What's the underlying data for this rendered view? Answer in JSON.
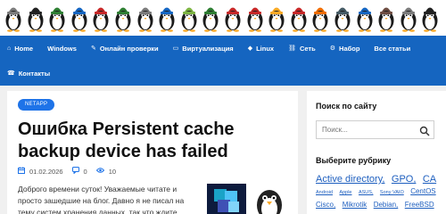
{
  "banner": {
    "penguins": [
      {
        "color": "#7a7a7a"
      },
      {
        "color": "#222222"
      },
      {
        "color": "#2e7d32"
      },
      {
        "color": "#1565c0"
      },
      {
        "color": "#c62828"
      },
      {
        "color": "#2e7d32"
      },
      {
        "color": "#7a7a7a"
      },
      {
        "color": "#1565c0"
      },
      {
        "color": "#7cb342"
      },
      {
        "color": "#2e7d32"
      },
      {
        "color": "#c62828"
      },
      {
        "color": "#c62828"
      },
      {
        "color": "#f9a825"
      },
      {
        "color": "#c62828"
      },
      {
        "color": "#ef6c00"
      },
      {
        "color": "#455a64"
      },
      {
        "color": "#1565c0"
      },
      {
        "color": "#6d4c41"
      },
      {
        "color": "#7a7a7a"
      },
      {
        "color": "#222222"
      }
    ]
  },
  "nav": {
    "row1": [
      {
        "label": "Home",
        "icon": "home-icon"
      },
      {
        "label": "Windows",
        "icon": ""
      },
      {
        "label": "Онлайн проверки",
        "icon": "wrench-icon"
      },
      {
        "label": "Виртуализация",
        "icon": "desktop-icon"
      },
      {
        "label": "Linux",
        "icon": "linux-icon"
      },
      {
        "label": "Сеть",
        "icon": "network-icon"
      },
      {
        "label": "Набор",
        "icon": "gear-icon"
      },
      {
        "label": "Все статьи",
        "icon": ""
      }
    ],
    "row2": [
      {
        "label": "Контакты",
        "icon": "phone-icon"
      }
    ]
  },
  "article": {
    "tag": "NETAPP",
    "title": "Ошибка Persistent cache backup device has failed",
    "date": "01.02.2026",
    "comments": "0",
    "views": "10",
    "excerpt": "Доброго времени суток! Уважаемые читате и просто зашедшие на блог. Давно я не писал на тему систем хранения данных, так что ждите"
  },
  "sidebar": {
    "search_title": "Поиск по сайту",
    "search_placeholder": "Поиск...",
    "categories_title": "Выберите рубрику",
    "categories": [
      {
        "label": "Active directory,",
        "size": "l"
      },
      {
        "label": "GPO,",
        "size": "l"
      },
      {
        "label": "CA",
        "size": "l"
      },
      {
        "label": "Android",
        "size": "s"
      },
      {
        "label": "Apple",
        "size": "s"
      },
      {
        "label": "ASUS,",
        "size": "s"
      },
      {
        "label": "Sony VAIO",
        "size": "s"
      },
      {
        "label": "CentOS",
        "size": "m"
      },
      {
        "label": "Cisco,",
        "size": "m"
      },
      {
        "label": "Mikrotik",
        "size": "m"
      },
      {
        "label": "Debian,",
        "size": "m"
      },
      {
        "label": "FreeBSD",
        "size": "m"
      }
    ]
  },
  "colors": {
    "nav_bg": "#1565c0",
    "accent": "#1e73e8",
    "link": "#1e5fbf"
  }
}
